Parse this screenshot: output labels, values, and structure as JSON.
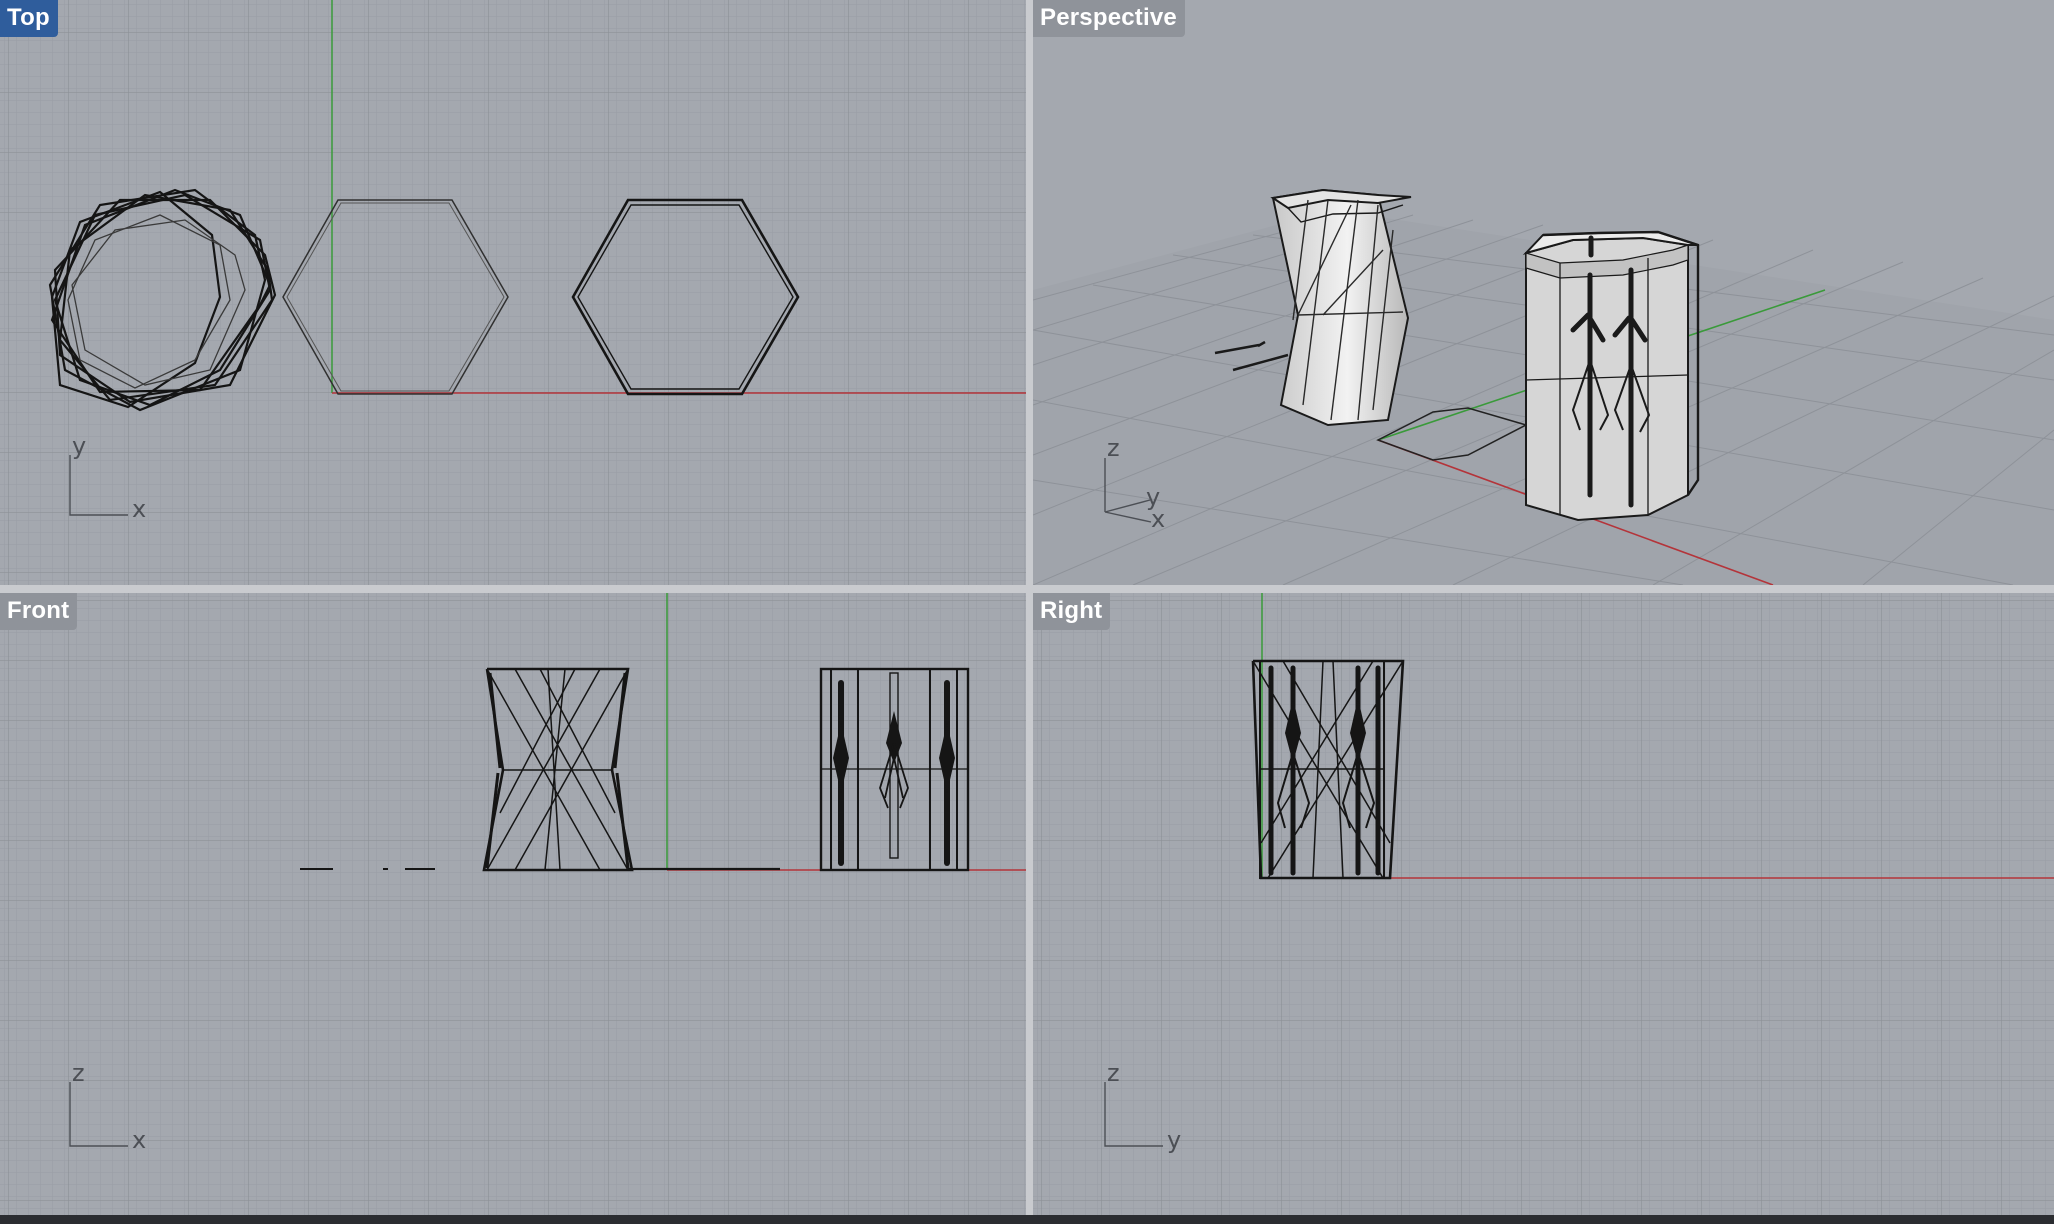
{
  "viewports": {
    "top": {
      "label": "Top",
      "axes": [
        "y",
        "x"
      ],
      "active": true
    },
    "perspective": {
      "label": "Perspective",
      "axes": [
        "z",
        "y",
        "x"
      ],
      "active": false
    },
    "front": {
      "label": "Front",
      "axes": [
        "z",
        "x"
      ],
      "active": false
    },
    "right": {
      "label": "Right",
      "axes": [
        "z",
        "y"
      ],
      "active": false
    }
  },
  "colors": {
    "viewport_bg": "#a4a8af",
    "grid_minor": "#999da4",
    "grid_major": "#8d9198",
    "x_axis": "#b4343a",
    "y_axis": "#3a9a3a",
    "active_label": "#2f5d9c",
    "geometry": "#151515",
    "surface": "#dcdcdc"
  }
}
